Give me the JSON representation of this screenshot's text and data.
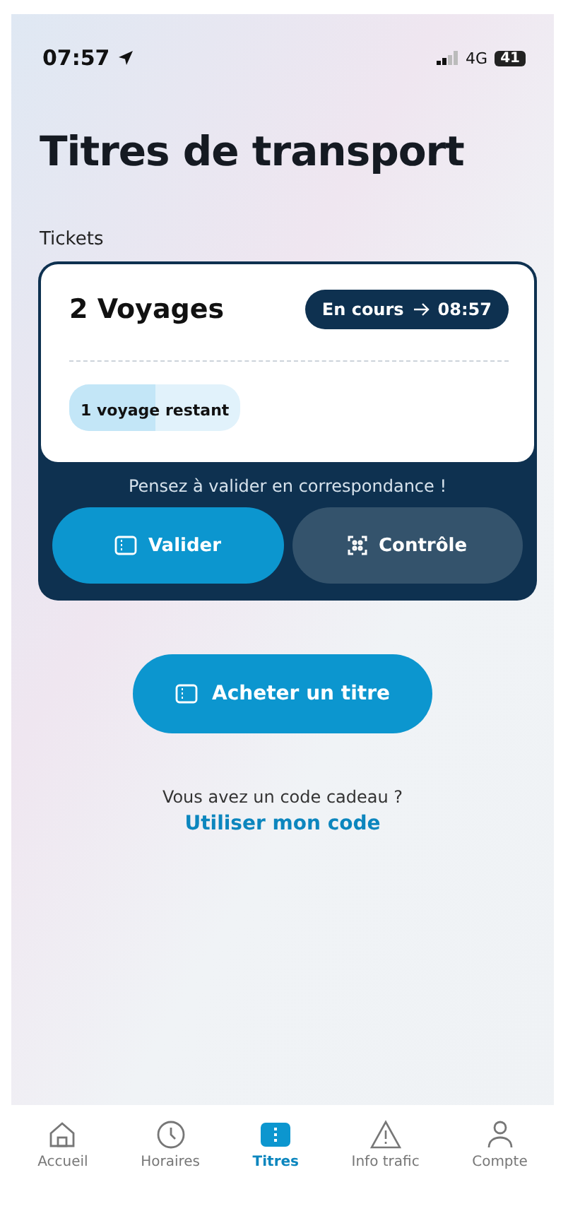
{
  "status_bar": {
    "time": "07:57",
    "network": "4G",
    "battery": "41"
  },
  "title": "Titres de transport",
  "section": "Tickets",
  "ticket": {
    "name": "2 Voyages",
    "status": "En cours",
    "until": "08:57",
    "remaining": {
      "label": "1 voyage restant",
      "level": 0.5
    },
    "hint": "Pensez à valider en correspondance !",
    "actions": [
      {
        "kind": "validate",
        "label": "Valider",
        "primary": true
      },
      {
        "kind": "control",
        "label": "Contrôle",
        "primary": false
      }
    ]
  },
  "buy_button": "Acheter un titre",
  "gift": {
    "question": "Vous avez un code cadeau ?",
    "link": "Utiliser mon code"
  },
  "tabs": [
    {
      "kind": "home",
      "label": "Accueil",
      "selected": false
    },
    {
      "kind": "clock",
      "label": "Horaires",
      "selected": false
    },
    {
      "kind": "ticket",
      "label": "Titres",
      "selected": true
    },
    {
      "kind": "alert",
      "label": "Info trafic",
      "selected": false
    },
    {
      "kind": "user",
      "label": "Compte",
      "selected": false
    }
  ]
}
